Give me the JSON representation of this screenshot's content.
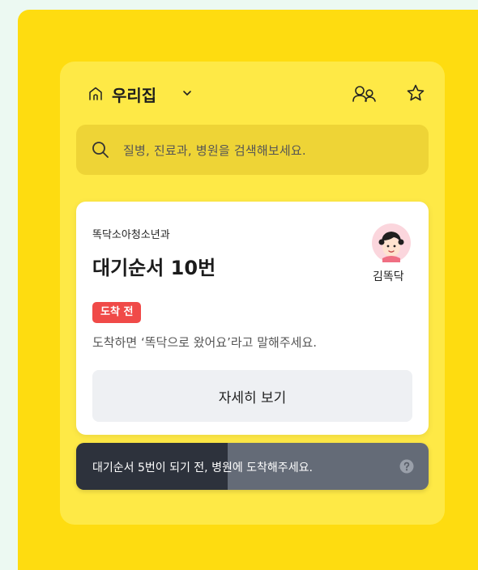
{
  "header": {
    "location_label": "우리집"
  },
  "search": {
    "placeholder": "질병, 진료과, 병원을 검색해보세요."
  },
  "card": {
    "clinic_name": "똑닥소아청소년과",
    "queue_status": "대기순서 10번",
    "patient_name": "김똑닥",
    "badge": "도착 전",
    "guide_text": "도착하면 ‘똑닥으로 왔어요’라고 말해주세요.",
    "detail_button": "자세히 보기"
  },
  "toast": {
    "message": "대기순서 5번이 되기 전, 병원에 도착해주세요.",
    "progress": 0.43
  },
  "icons": {
    "home": "home-icon",
    "chevron": "chevron-down-icon",
    "family": "people-icon",
    "favorite": "star-icon",
    "search": "search-icon",
    "avatar": "child-avatar",
    "help": "question-icon"
  },
  "colors": {
    "brand_yellow": "#fedc10",
    "panel_yellow": "#fee946",
    "badge_red": "#f04a48",
    "toast_dark": "#2d323c",
    "toast_gray": "#646b77"
  }
}
